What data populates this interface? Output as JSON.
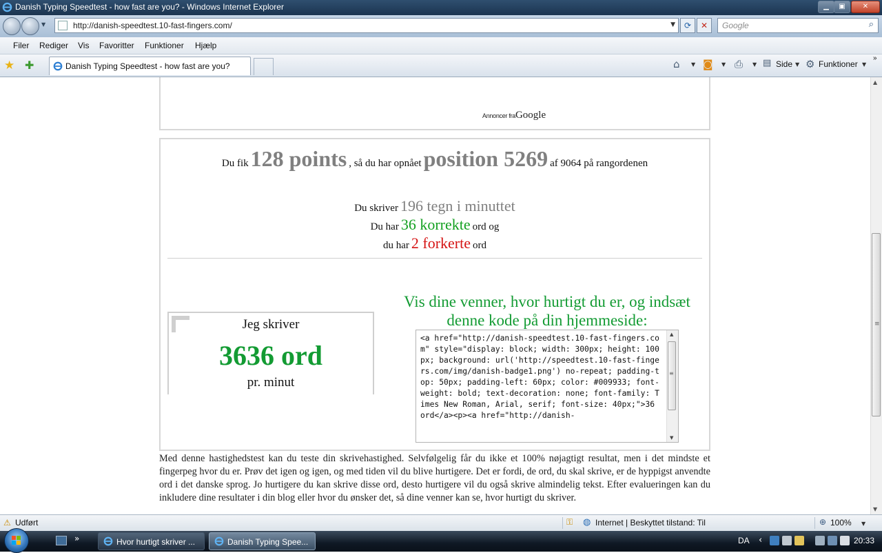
{
  "window": {
    "title": "Danish Typing Speedtest - how fast are you? - Windows Internet Explorer"
  },
  "address": {
    "url": "http://danish-speedtest.10-fast-fingers.com/",
    "search_placeholder": "Google"
  },
  "menu": {
    "items": [
      "Filer",
      "Rediger",
      "Vis",
      "Favoritter",
      "Funktioner",
      "Hjælp"
    ]
  },
  "tabs": {
    "active_title": "Danish Typing Speedtest - how fast are you?"
  },
  "commands": {
    "page_label": "Side",
    "tools_label": "Funktioner"
  },
  "ad": {
    "prefix": "Annoncer fra",
    "brand": "Google"
  },
  "result": {
    "line1_pre": "Du fik",
    "points": "128 points",
    "line1_mid": ", så du har opnået",
    "position": "position 5269",
    "line1_post": "af 9064 på rangordenen",
    "line2_pre": "Du skriver",
    "chars": "196 tegn i minuttet",
    "line3_pre": "Du har",
    "correct": "36 korrekte",
    "line3_post": "ord og",
    "line4_pre": "du har",
    "wrong": "2 forkerte",
    "line4_post": "ord"
  },
  "badge": {
    "line1": "Jeg skriver",
    "line2": "3636 ord",
    "line3": "pr. minut"
  },
  "share": {
    "heading": "Vis dine venner, hvor hurtigt du er, og indsæt denne kode på din hjemmeside:",
    "code": "<a href=\"http://danish-speedtest.10-fast-fingers.com\" style=\"display: block; width: 300px; height: 100px; background: url('http://speedtest.10-fast-fingers.com/img/danish-badge1.png') no-repeat; padding-top: 50px; padding-left: 60px; color: #009933; font-weight: bold; text-decoration: none; font-family: Times New Roman, Arial, serif; font-size: 40px;\">36 ord</a><p><a href=\"http://danish-"
  },
  "description": "Med denne hastighedstest kan du teste din skrivehastighed. Selvfølgelig får du ikke et 100% nøjagtigt resultat, men i det mindste et fingerpeg hvor du er. Prøv det igen og igen, og med tiden vil du blive hurtigere. Det er fordi, de ord, du skal skrive, er de hyppigst anvendte ord i det danske sprog. Jo hurtigere du kan skrive disse ord, desto hurtigere vil du også skrive almindelig tekst. Efter evalueringen kan du inkludere dine resultater i din blog eller hvor du ønsker det, så dine venner kan se, hvor hurtigt du skriver.",
  "status": {
    "text": "Udført",
    "zone": "Internet | Beskyttet tilstand: Til",
    "zoom": "100%"
  },
  "taskbar": {
    "tasks": [
      "Hvor hurtigt skriver ...",
      "Danish Typing Spee..."
    ],
    "lang": "DA",
    "clock": "20:33"
  },
  "colors": {
    "green": "#139b33",
    "red": "#d51313",
    "gray": "#808080"
  }
}
